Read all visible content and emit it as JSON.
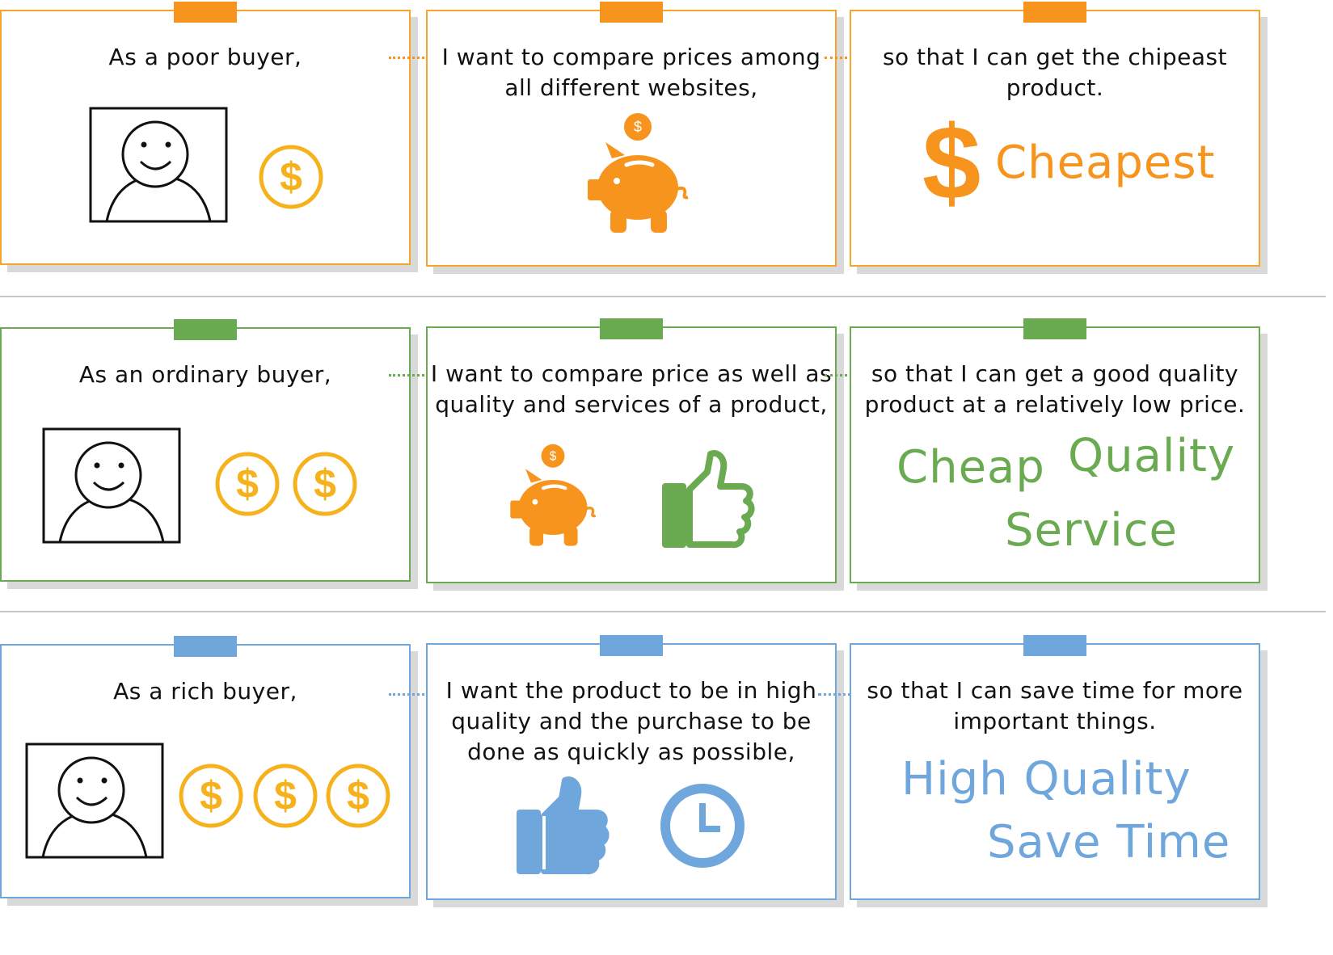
{
  "rows": [
    {
      "theme": "orange",
      "role": "As a poor buyer,",
      "want": "I want to compare prices among\nall different websites,",
      "goal": "so that I can get the chipeast\nproduct.",
      "keywords": [
        "Cheapest"
      ],
      "symbols": [
        "$"
      ],
      "coin_count": 1,
      "icons": [
        "piggy-bank-icon"
      ]
    },
    {
      "theme": "green",
      "role": "As an ordinary buyer,",
      "want": "I want to compare price as well as\nquality and services of a product,",
      "goal": "so that I can get a good quality\nproduct at a relatively low price.",
      "keywords": [
        "Cheap",
        "Quality",
        "Service"
      ],
      "coin_count": 2,
      "icons": [
        "piggy-bank-icon",
        "thumbs-up-icon"
      ]
    },
    {
      "theme": "blue",
      "role": "As a rich buyer,",
      "want": "I want the product to be in high\nquality and the purchase to be\ndone as quickly as possible,",
      "goal": "so that I can save time for more\nimportant things.",
      "keywords": [
        "High Quality",
        "Save Time"
      ],
      "coin_count": 3,
      "icons": [
        "thumbs-up-icon",
        "clock-icon"
      ]
    }
  ],
  "colors": {
    "orange": "#f7941d",
    "green": "#6aaa50",
    "blue": "#6fa6db",
    "coin": "#f5b21d"
  }
}
